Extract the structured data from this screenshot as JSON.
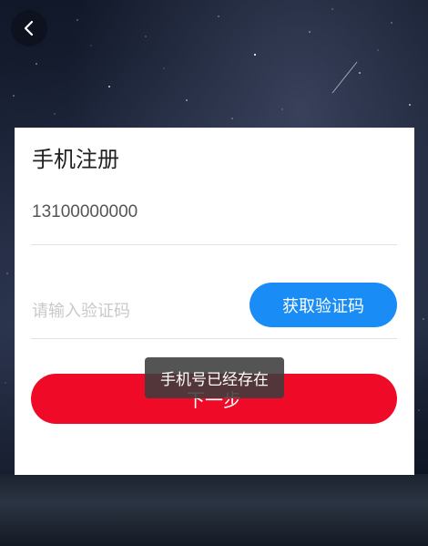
{
  "nav": {
    "back_icon": "chevron-left-icon"
  },
  "card": {
    "title": "手机注册",
    "phone_value": "13100000000",
    "code_placeholder": "请输入验证码",
    "get_code_label": "获取验证码",
    "next_label": "下一步"
  },
  "toast": {
    "message": "手机号已经存在"
  },
  "colors": {
    "primary_blue": "#1a8cf5",
    "primary_red": "#ef0b27",
    "toast_bg": "#3c3c3c"
  }
}
